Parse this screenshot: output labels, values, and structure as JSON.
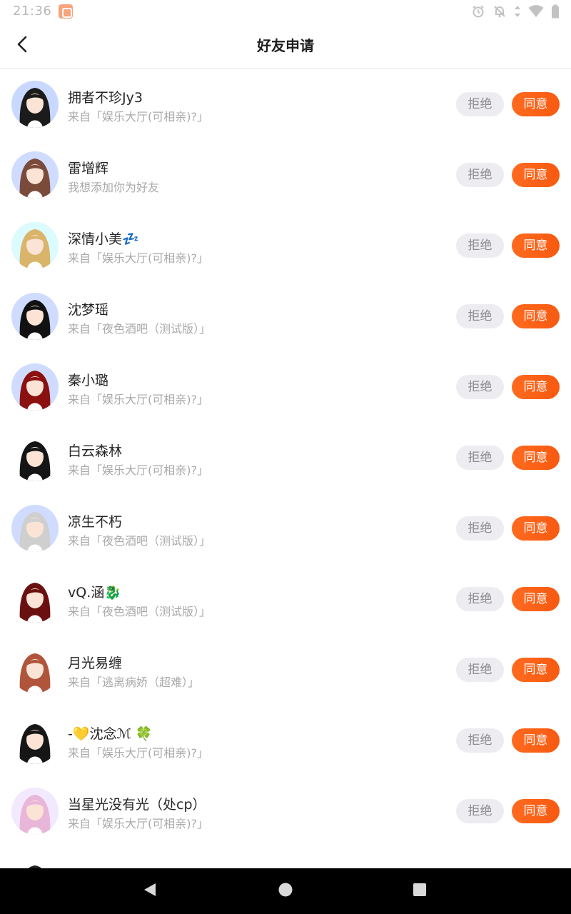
{
  "status_bar": {
    "time": "21:36",
    "icons": [
      "app-notification-icon",
      "alarm-icon",
      "notifications-off-icon",
      "data-arrows-icon",
      "wifi-icon",
      "battery-icon"
    ]
  },
  "header": {
    "title": "好友申请",
    "back_icon": "chevron-left-icon"
  },
  "buttons": {
    "reject_label": "拒绝",
    "accept_label": "同意"
  },
  "colors": {
    "accent": "#FA5E14",
    "reject_bg": "#ECECF1",
    "reject_text": "#8D8D8D",
    "secondary_text": "#A9A9A9"
  },
  "requests": [
    {
      "name": "拥者不珍Jy3",
      "source": "来自「娱乐大厅(可相亲)?」",
      "avatar_hair": "#1b1b1b",
      "avatar_bg": "#c9d8ff"
    },
    {
      "name": "雷增辉",
      "source": "我想添加你为好友",
      "avatar_hair": "#7a4a3a",
      "avatar_bg": "#cfdcff"
    },
    {
      "name": "深情小美💤",
      "source": "来自「娱乐大厅(可相亲)?」",
      "avatar_hair": "#d9b46a",
      "avatar_bg": "#dcfbff"
    },
    {
      "name": "沈梦瑶",
      "source": "来自「夜色酒吧（测试版）」",
      "avatar_hair": "#111111",
      "avatar_bg": "#cfdcff"
    },
    {
      "name": "秦小璐",
      "source": "来自「娱乐大厅(可相亲)?」",
      "avatar_hair": "#8b1111",
      "avatar_bg": "#cfdcff"
    },
    {
      "name": "白云森林",
      "source": "来自「娱乐大厅(可相亲)?」",
      "avatar_hair": "#151515",
      "avatar_bg": "#ffffff"
    },
    {
      "name": "凉生不朽",
      "source": "来自「夜色酒吧（测试版）」",
      "avatar_hair": "#cfcfcf",
      "avatar_bg": "#cfdcff"
    },
    {
      "name": "vQ.涵🐉",
      "source": "来自「夜色酒吧（测试版）」",
      "avatar_hair": "#6b1010",
      "avatar_bg": "#ffffff"
    },
    {
      "name": "月光易缠",
      "source": "来自「逃离病娇（超难）」",
      "avatar_hair": "#b0553c",
      "avatar_bg": "#ffffff"
    },
    {
      "name": "-💛沈念ℳ 🍀",
      "source": "来自「娱乐大厅(可相亲)?」",
      "avatar_hair": "#161616",
      "avatar_bg": "#ffffff"
    },
    {
      "name": "当星光没有光（处cp）",
      "source": "来自「娱乐大厅(可相亲)?」",
      "avatar_hair": "#e8b6d9",
      "avatar_bg": "#f3e9ff"
    }
  ],
  "partial_row": {
    "avatar_hair": "#222222"
  },
  "nav": {
    "back_icon": "nav-back-triangle-icon",
    "home_icon": "nav-home-circle-icon",
    "recents_icon": "nav-recents-square-icon"
  }
}
